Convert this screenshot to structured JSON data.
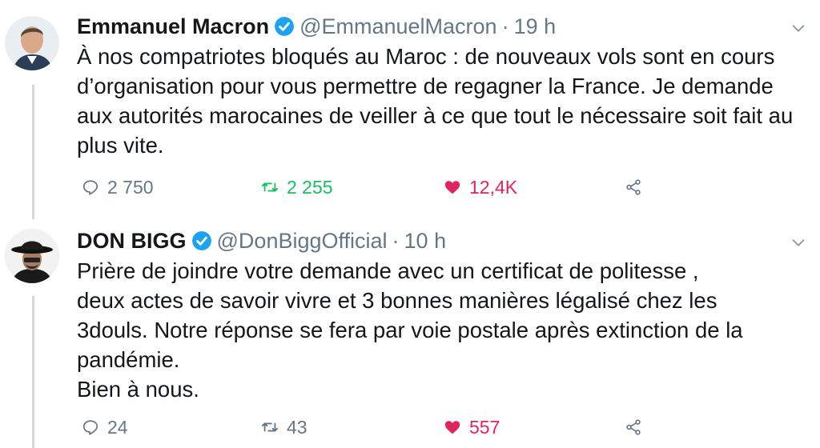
{
  "tweets": [
    {
      "name": "Emmanuel Macron",
      "handle": "@EmmanuelMacron",
      "separator": "·",
      "time": "19 h",
      "text": "À nos compatriotes bloqués au Maroc : de nouveaux vols sont en cours d’organisation pour vous permettre de regagner la France. Je demande aux autorités marocaines de veiller à ce que tout le nécessaire soit fait au plus vite.",
      "replies": "2 750",
      "retweets": "2 255",
      "likes": "12,4K",
      "verified": true,
      "retweeted": true,
      "liked": true
    },
    {
      "name": "DON BIGG",
      "handle": "@DonBiggOfficial",
      "separator": "·",
      "time": "10 h",
      "text_lines": [
        "Prière de joindre votre demande avec un certificat de politesse ,",
        "deux actes de savoir vivre et 3 bonnes manières légalisé chez les",
        "3douls. Notre réponse se fera par voie postale après extinction de la",
        "pandémie.",
        "Bien à nous."
      ],
      "replies": "24",
      "retweets": "43",
      "likes": "557",
      "verified": true,
      "retweeted": false,
      "liked": true
    }
  ],
  "icons": {
    "reply": "reply-icon",
    "retweet": "retweet-icon",
    "like": "heart-icon",
    "share": "share-icon",
    "verified": "verified-badge-icon",
    "menu": "chevron-down-icon"
  },
  "colors": {
    "text": "#14171a",
    "secondary": "#657786",
    "verified": "#1da1f2",
    "retweet": "#17bf63",
    "like": "#e0245e",
    "thread_line": "#cfd9de"
  }
}
